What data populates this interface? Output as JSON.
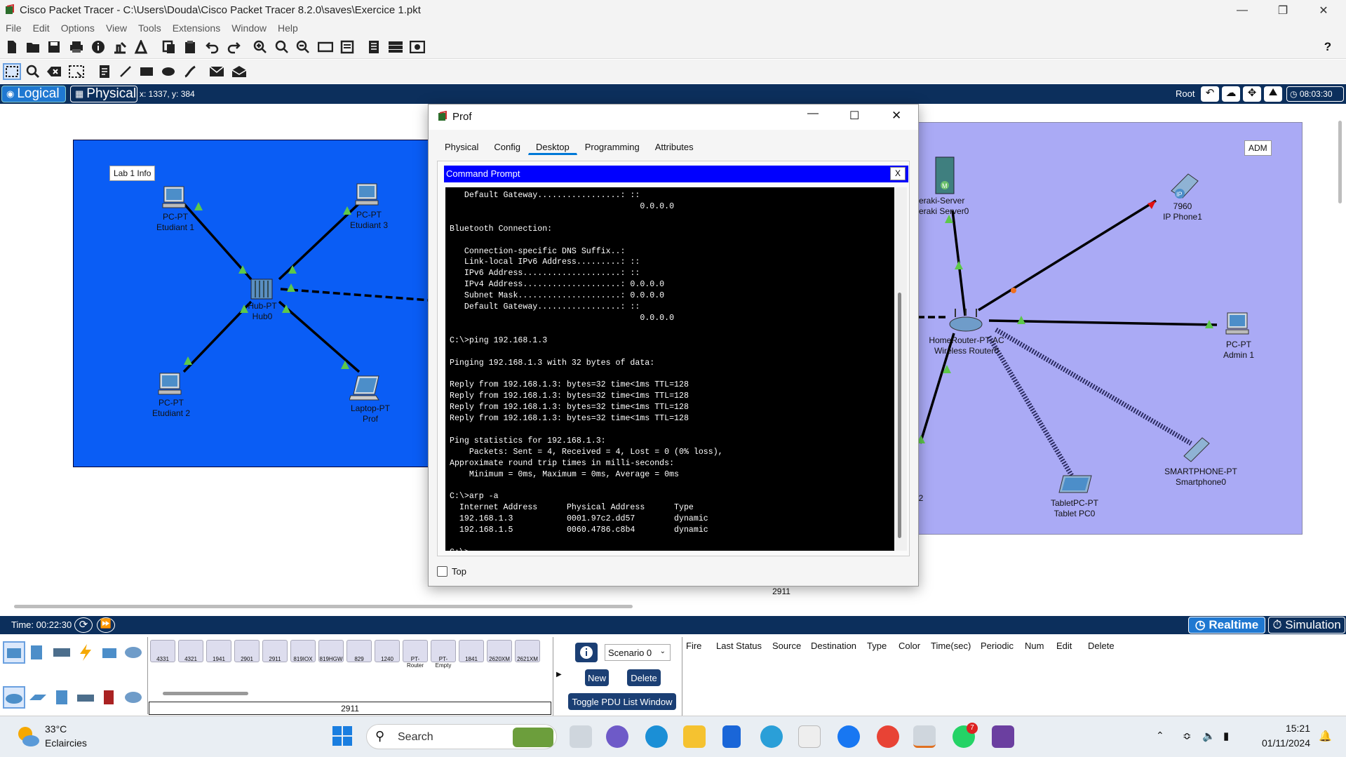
{
  "window": {
    "title": "Cisco Packet Tracer - C:\\Users\\Douda\\Cisco Packet Tracer 8.2.0\\saves\\Exercice 1.pkt"
  },
  "menu": [
    "File",
    "Edit",
    "Options",
    "View",
    "Tools",
    "Extensions",
    "Window",
    "Help"
  ],
  "nav": {
    "logical": "Logical",
    "physical": "Physical",
    "coords": "x: 1337, y: 384",
    "root": "Root",
    "clock": "08:03:30"
  },
  "workspace": {
    "lab1": {
      "note": "Lab 1 Info",
      "devices": [
        {
          "type": "PC-PT",
          "name": "Etudiant 1"
        },
        {
          "type": "PC-PT",
          "name": "Etudiant 3"
        },
        {
          "type": "Hub-PT",
          "name": "Hub0"
        },
        {
          "type": "PC-PT",
          "name": "Etudiant 2"
        },
        {
          "type": "Laptop-PT",
          "name": "Prof"
        }
      ]
    },
    "adm": {
      "note": "ADM",
      "devices": [
        {
          "type": "Meraki-Server",
          "name": "Meraki Server0"
        },
        {
          "type": "7960",
          "name": "IP Phone1"
        },
        {
          "type": "HomeRouter-PT-AC",
          "name": "Wireless Router0"
        },
        {
          "type": "PC-PT",
          "name": "Admin 1"
        },
        {
          "type": "SMARTPHONE-PT",
          "name": "Smartphone0"
        },
        {
          "type": "TabletPC-PT",
          "name": "Tablet PC0"
        }
      ],
      "partial": "2"
    },
    "bottom_label": "2911"
  },
  "dialog": {
    "title": "Prof",
    "tabs": [
      "Physical",
      "Config",
      "Desktop",
      "Programming",
      "Attributes"
    ],
    "active_tab": "Desktop",
    "cmd_title": "Command Prompt",
    "cmd_close": "X",
    "terminal": "   Default Gateway.................: ::\n                                       0.0.0.0\n\nBluetooth Connection:\n\n   Connection-specific DNS Suffix..:\n   Link-local IPv6 Address.........: ::\n   IPv6 Address....................: ::\n   IPv4 Address....................: 0.0.0.0\n   Subnet Mask.....................: 0.0.0.0\n   Default Gateway.................: ::\n                                       0.0.0.0\n\nC:\\>ping 192.168.1.3\n\nPinging 192.168.1.3 with 32 bytes of data:\n\nReply from 192.168.1.3: bytes=32 time<1ms TTL=128\nReply from 192.168.1.3: bytes=32 time<1ms TTL=128\nReply from 192.168.1.3: bytes=32 time<1ms TTL=128\nReply from 192.168.1.3: bytes=32 time<1ms TTL=128\n\nPing statistics for 192.168.1.3:\n    Packets: Sent = 4, Received = 4, Lost = 0 (0% loss),\nApproximate round trip times in milli-seconds:\n    Minimum = 0ms, Maximum = 0ms, Average = 0ms\n\nC:\\>arp -a\n  Internet Address      Physical Address      Type\n  192.168.1.3           0001.97c2.dd57        dynamic\n  192.168.1.5           0060.4786.c8b4        dynamic\n\nC:\\>",
    "top_checkbox": "Top"
  },
  "timebar": {
    "time": "Time: 00:22:30",
    "realtime": "Realtime",
    "simulation": "Simulation"
  },
  "device_models": [
    "4331",
    "4321",
    "1941",
    "2901",
    "2911",
    "819IOX",
    "819HGW",
    "829",
    "1240",
    "PT-Router",
    "PT-Empty",
    "1841",
    "2620XM",
    "2621XM"
  ],
  "selected_model": "2911",
  "scenario": {
    "value": "Scenario 0",
    "new": "New",
    "delete": "Delete",
    "toggle": "Toggle PDU List Window"
  },
  "pdu_headers": [
    "Fire",
    "Last Status",
    "Source",
    "Destination",
    "Type",
    "Color",
    "Time(sec)",
    "Periodic",
    "Num",
    "Edit",
    "Delete"
  ],
  "taskbar": {
    "temp": "33°C",
    "weather": "Eclaircies",
    "search": "Search",
    "time": "15:21",
    "date": "01/11/2024",
    "whatsapp_badge": "7"
  }
}
